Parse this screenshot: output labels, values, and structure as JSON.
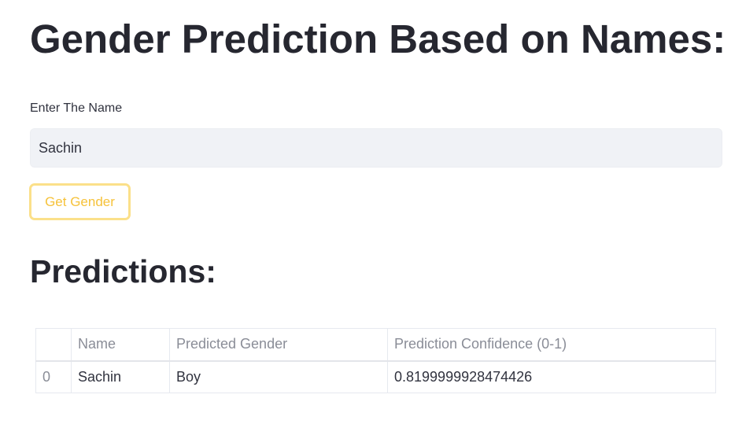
{
  "header": {
    "title": "Gender Prediction Based on Names:"
  },
  "form": {
    "input_label": "Enter The Name",
    "input_value": "Sachin",
    "button_label": "Get Gender"
  },
  "results": {
    "heading": "Predictions:",
    "columns": [
      "",
      "Name",
      "Predicted Gender",
      "Prediction Confidence (0-1)"
    ],
    "rows": [
      {
        "index": "0",
        "name": "Sachin",
        "gender": "Boy",
        "confidence": "0.8199999928474426"
      }
    ]
  },
  "colors": {
    "button_border": "#fbe08a",
    "button_text": "#f6c23a",
    "input_bg": "#f0f2f6"
  }
}
